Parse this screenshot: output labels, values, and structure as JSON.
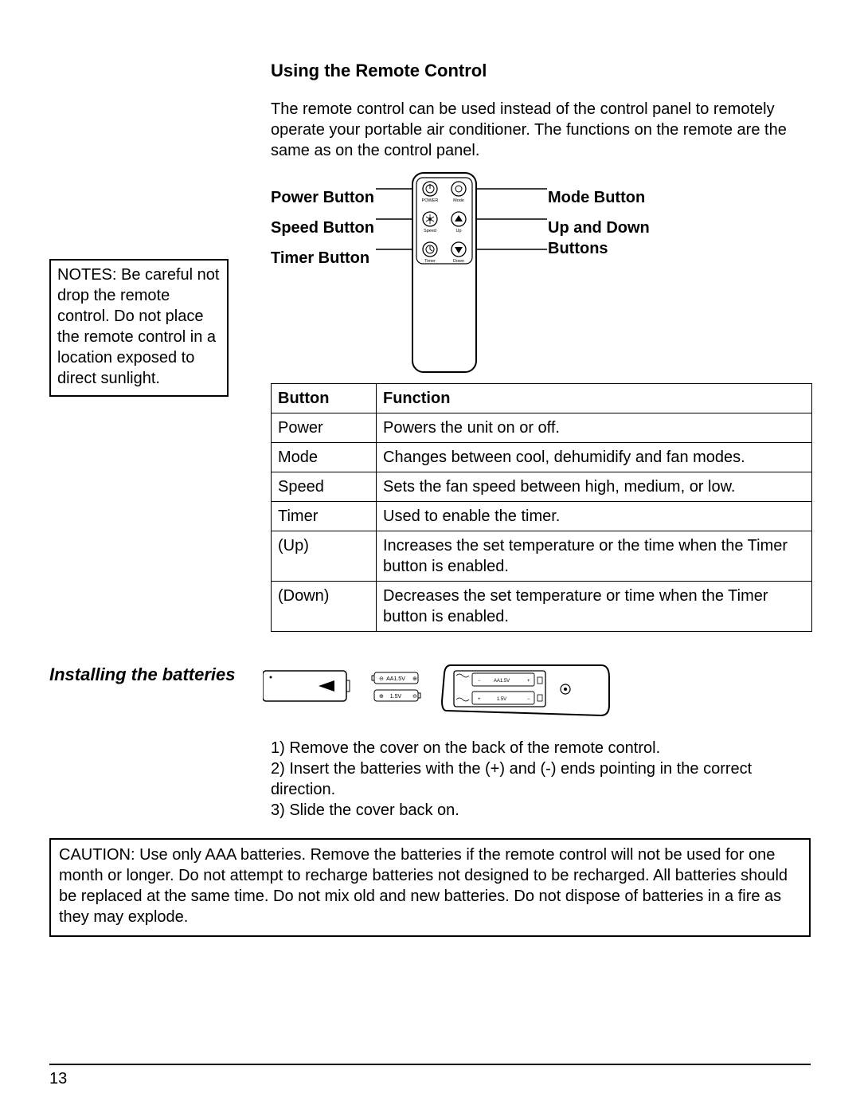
{
  "section_title": "Using the Remote Control",
  "intro": "The remote control can be used instead of the control panel to remotely operate your portable air conditioner. The functions on the remote are the same as on the control panel.",
  "notes": "NOTES: Be careful not drop the remote control. Do not place the remote control in a location exposed to direct sunlight.",
  "labels": {
    "power": "Power Button",
    "mode": "Mode Button",
    "speed": "Speed Button",
    "updown": "Up and Down Buttons",
    "timer": "Timer Button"
  },
  "remote_button_text": {
    "power": "POWER",
    "mode": "Mode",
    "speed": "Speed",
    "up": "Up",
    "timer": "Timer",
    "down": "Down"
  },
  "table": {
    "headers": {
      "button": "Button",
      "function": "Function"
    },
    "rows": [
      {
        "button": "Power",
        "function": "Powers the unit on or off."
      },
      {
        "button": "Mode",
        "function": "Changes between cool, dehumidify and fan modes."
      },
      {
        "button": "Speed",
        "function": "Sets the fan speed between high, medium, or low."
      },
      {
        "button": "Timer",
        "function": "Used to enable the timer."
      },
      {
        "button": "(Up)",
        "function": "Increases the set temperature or the time when the Timer button is enabled.",
        "indent": true
      },
      {
        "button": "(Down)",
        "function": "Decreases the set temperature or time when the Timer button is enabled.",
        "indent": true
      }
    ]
  },
  "batteries": {
    "title": "Installing the batteries",
    "battery_label_a": "AA1.5V",
    "battery_label_b": "1.5V",
    "steps": [
      "1) Remove the cover on the back of the remote control.",
      "2) Insert the batteries with the (+) and (-) ends pointing in the correct direction.",
      "3) Slide the cover back on."
    ]
  },
  "caution": "CAUTION: Use only AAA batteries. Remove the batteries if the remote control will not be used for one month or longer. Do not attempt to recharge batteries not designed to be recharged.  All batteries should be replaced at the same time. Do not mix old and new batteries. Do not dispose of batteries in a fire as they may explode.",
  "page_number": "13"
}
